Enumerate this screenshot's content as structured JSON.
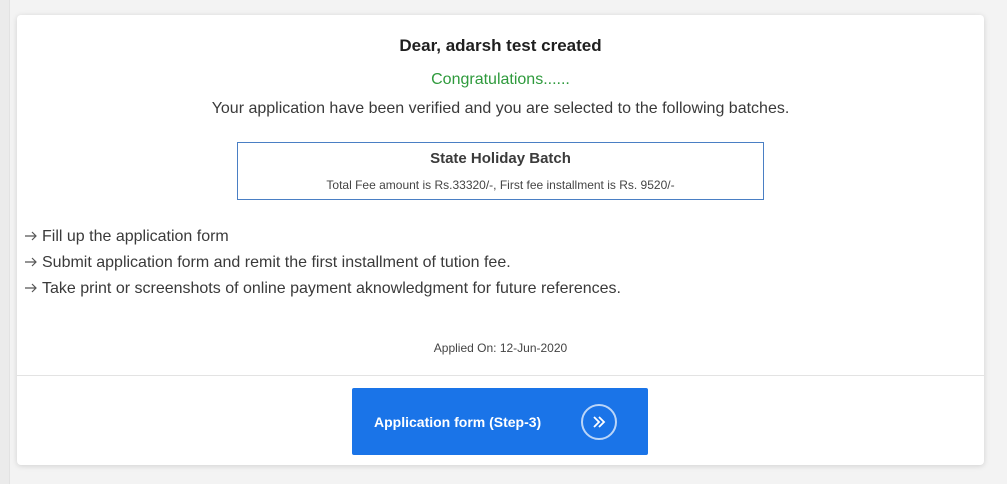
{
  "colors": {
    "accent": "#1a74e8",
    "success_text": "#2e9a3c",
    "box_border": "#4a7fc4"
  },
  "greeting": "Dear, adarsh test created",
  "congrats": "Congratulations......",
  "message": "Your application have been verified and you are selected to the following batches.",
  "batch": {
    "name": "State Holiday Batch",
    "fee_text": "Total Fee amount is Rs.33320/-, First fee installment is Rs. 9520/-"
  },
  "steps": [
    {
      "arrow_icon": "right-arrow-icon",
      "text": "Fill up the application form"
    },
    {
      "arrow_icon": "right-arrow-icon",
      "text": "Submit application form and remit the first installment of tution fee."
    },
    {
      "arrow_icon": "right-arrow-icon",
      "text": "Take print or screenshots of online payment aknowledgment for future references."
    }
  ],
  "applied_on": "Applied On: 12-Jun-2020",
  "cta": {
    "label": "Application form (Step-3)",
    "icon": "double-chevron-right-icon"
  }
}
